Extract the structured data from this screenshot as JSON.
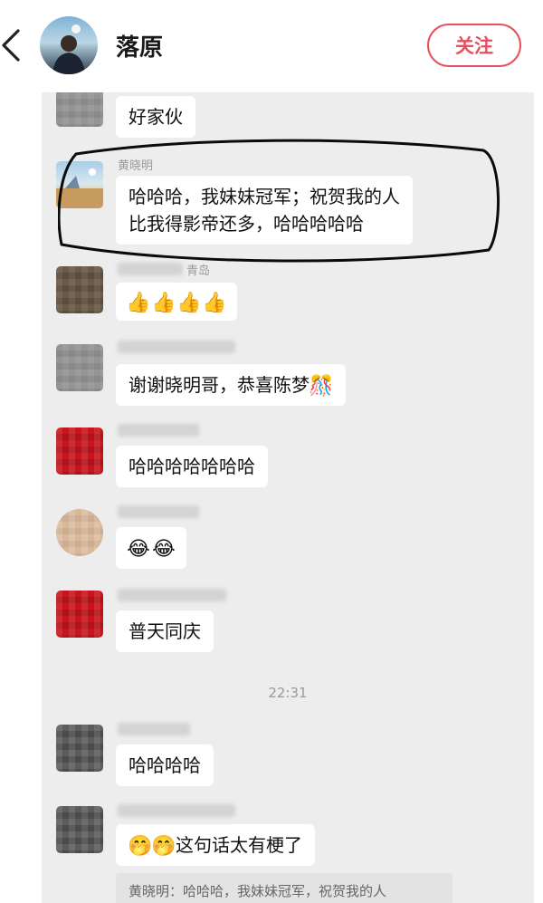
{
  "header": {
    "contact_name": "落原",
    "follow_label": "关注",
    "back_icon": "chevron-left-icon",
    "avatar": "profile-photo-man-at-sea"
  },
  "messages": [
    {
      "sender": "",
      "text": "好家伙",
      "avatar": "blurred-gray"
    },
    {
      "sender": "黄晓明",
      "text_line1": "哈哈哈，我妹妹冠军；祝贺我的人",
      "text_line2": "比我得影帝还多，哈哈哈哈哈",
      "avatar": "scenery"
    },
    {
      "sender": "青岛",
      "emoji": [
        "👍",
        "👍",
        "👍",
        "👍"
      ],
      "avatar": "blurred-dark"
    },
    {
      "sender": "",
      "text": "谢谢晓明哥，恭喜陈梦",
      "emoji_after": "🎊",
      "avatar": "blurred-gray"
    },
    {
      "sender": "",
      "text": "哈哈哈哈哈哈哈",
      "avatar": "blurred-red"
    },
    {
      "sender": "",
      "emoji": [
        "😂",
        "😂"
      ],
      "avatar": "blurred-beige"
    },
    {
      "sender": "",
      "text": "普天同庆",
      "avatar": "blurred-red"
    },
    {
      "sender": "",
      "text": "哈哈哈哈",
      "avatar": "blurred-gray-black"
    },
    {
      "sender": "",
      "emoji_before": [
        "🤭",
        "🤭"
      ],
      "text": "这句话太有梗了",
      "avatar": "blurred-gray-black"
    }
  ],
  "timestamp": "22:31",
  "quote": "黄晓明：哈哈哈，我妹妹冠军，祝贺我的人",
  "colors": {
    "accent": "#e8505b",
    "chat_bg": "#ededed",
    "bubble": "#ffffff"
  }
}
